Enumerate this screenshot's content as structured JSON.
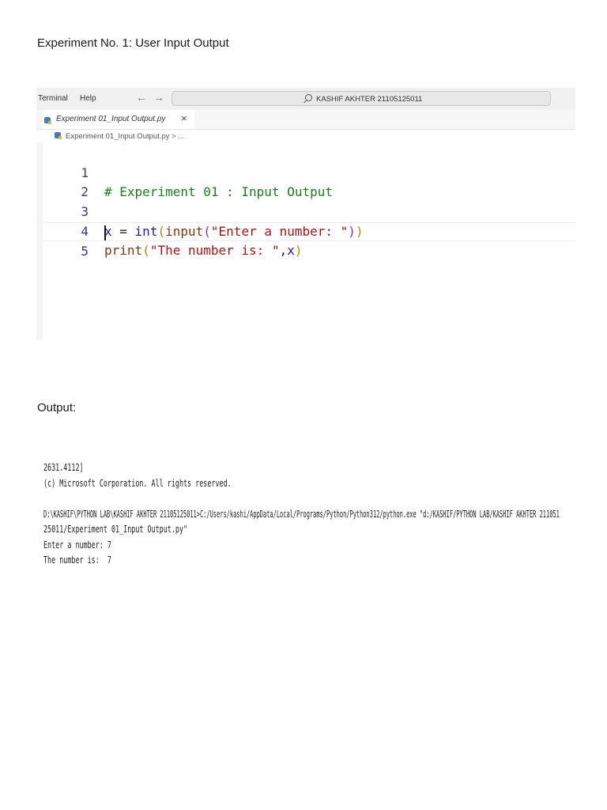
{
  "title": "Experiment No. 1: User Input Output",
  "output_heading": "Output:",
  "editor": {
    "menu": {
      "terminal": "Terminal",
      "help": "Help"
    },
    "nav": {
      "back": "←",
      "forward": "→"
    },
    "search": "KASHIF AKHTER 21105125011",
    "tab": {
      "label": "Experiment 01_Input Output.py",
      "close": "×"
    },
    "breadcrumb": "Experiment 01_Input Output.py > ...",
    "lines": [
      {
        "no": "1"
      },
      {
        "no": "2"
      },
      {
        "no": "3"
      },
      {
        "no": "4"
      },
      {
        "no": "5"
      }
    ],
    "code": {
      "comment": "# Experiment 01 : Input Output",
      "l3_var": "x",
      "l3_eq": " = ",
      "l3_int": "int",
      "l3_p1": "(",
      "l3_input": "input",
      "l3_p2": "(",
      "l3_str": "\"Enter a number: \"",
      "l3_p3": ")",
      "l3_p4": ")",
      "l4_print": "print",
      "l4_p1": "(",
      "l4_str": "\"The number is: \"",
      "l4_comma": ",",
      "l4_x": "x",
      "l4_p2": ")"
    }
  },
  "console": [
    "2631.4112]",
    "(c) Microsoft Corporation. All rights reserved.",
    "",
    "D:\\KASHIF\\PYTHON LAB\\KASHIF AKHTER 21105125011>C:/Users/kashi/AppData/Local/Programs/Python/Python312/python.exe \"d:/KASHIF/PYTHON LAB/KASHIF AKHTER 211051",
    "25011/Experiment 01_Input Output.py\"",
    "Enter a number: 7",
    "The number is:  7"
  ]
}
